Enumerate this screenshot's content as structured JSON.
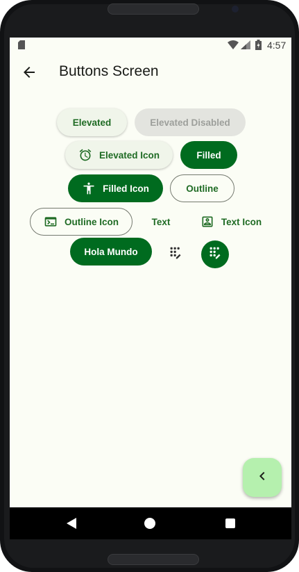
{
  "status_bar": {
    "time": "4:57",
    "icons": [
      "sd-card-icon",
      "wifi-icon",
      "signal-icon",
      "battery-icon"
    ]
  },
  "app_bar": {
    "title": "Buttons Screen",
    "back_icon": "arrow-back-icon"
  },
  "buttons": {
    "elevated": "Elevated",
    "elevated_disabled": "Elevated Disabled",
    "elevated_icon": "Elevated Icon",
    "filled": "Filled",
    "filled_icon": "Filled Icon",
    "outline": "Outline",
    "outline_icon": "Outline Icon",
    "text": "Text",
    "text_icon": "Text Icon",
    "hola_mundo": "Hola Mundo"
  },
  "icons": {
    "elevated_icon": "alarm-clock-icon",
    "filled_icon": "accessibility-person-icon",
    "outline_icon": "terminal-icon",
    "text_icon": "portrait-icon",
    "icon_button": "dialpad-edit-icon",
    "filled_icon_button": "dialpad-edit-icon",
    "fab": "chevron-left-icon"
  },
  "colors": {
    "primary": "#006b1f",
    "on_primary": "#ffffff",
    "surface": "#fbfdf5",
    "elevated_container": "#f0f5ea",
    "fab_container": "#b5f0ae",
    "disabled_container": "#e3e4df"
  },
  "nav_bar": {
    "buttons": [
      "back-triangle",
      "home-circle",
      "recents-square"
    ]
  }
}
